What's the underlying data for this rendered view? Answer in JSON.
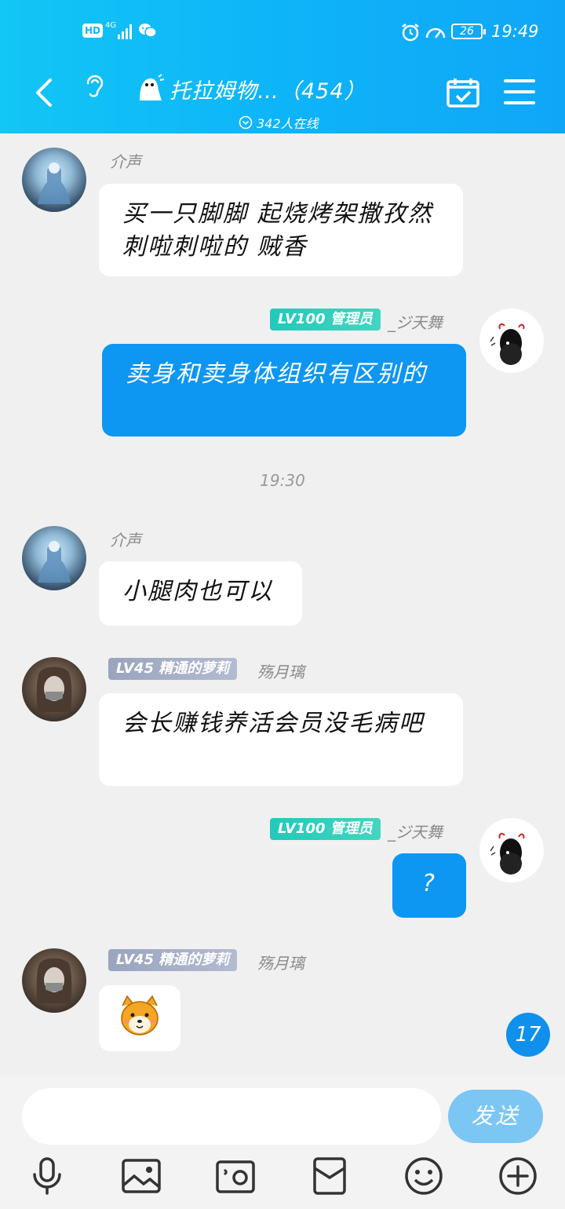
{
  "status_bar": {
    "hd": "HD",
    "network": "4G",
    "battery": "26",
    "time": "19:49"
  },
  "header": {
    "title": "托拉姆物…（454）",
    "online": "342人在线"
  },
  "messages": [
    {
      "sender": "介声",
      "side": "left",
      "avatar": "anime-girl-avatar",
      "text": "买一只脚脚  起烧烤架撒孜然  刺啦刺啦的 贼香"
    },
    {
      "sender": "_ジ天舞",
      "badge": "LV100 管理员",
      "badge_color": "#22c9b9",
      "side": "right",
      "avatar": "panda-avatar",
      "text": "卖身和卖身体组织有区别的"
    },
    {
      "sender": "介声",
      "side": "left",
      "avatar": "anime-girl-avatar",
      "text": "小腿肉也可以"
    },
    {
      "sender": "殇月璃",
      "badge": "LV45 精通的萝莉",
      "badge_color": "#9aa4be",
      "side": "left",
      "avatar": "masked-avatar",
      "text": "会长赚钱养活会员没毛病吧"
    },
    {
      "sender": "_ジ天舞",
      "badge": "LV100 管理员",
      "badge_color": "#22c9b9",
      "side": "right",
      "avatar": "panda-avatar",
      "text": "?"
    },
    {
      "sender": "殇月璃",
      "badge": "LV45 精通的萝莉",
      "badge_color": "#9aa4be",
      "side": "left",
      "avatar": "masked-avatar",
      "sticker": "shiba-dog-sticker"
    }
  ],
  "timestamp": "19:30",
  "unread_count": "17",
  "input": {
    "placeholder": "",
    "send_label": "发送"
  },
  "toolbar": [
    "microphone-icon",
    "image-icon",
    "camera-icon",
    "red-packet-icon",
    "emoji-icon",
    "plus-icon"
  ],
  "colors": {
    "header": "#10b4f8",
    "my_bubble": "#0d96f2",
    "admin_badge": "#22c9b9",
    "member_badge": "#9aa4be",
    "send_button": "#7cc6f4"
  }
}
